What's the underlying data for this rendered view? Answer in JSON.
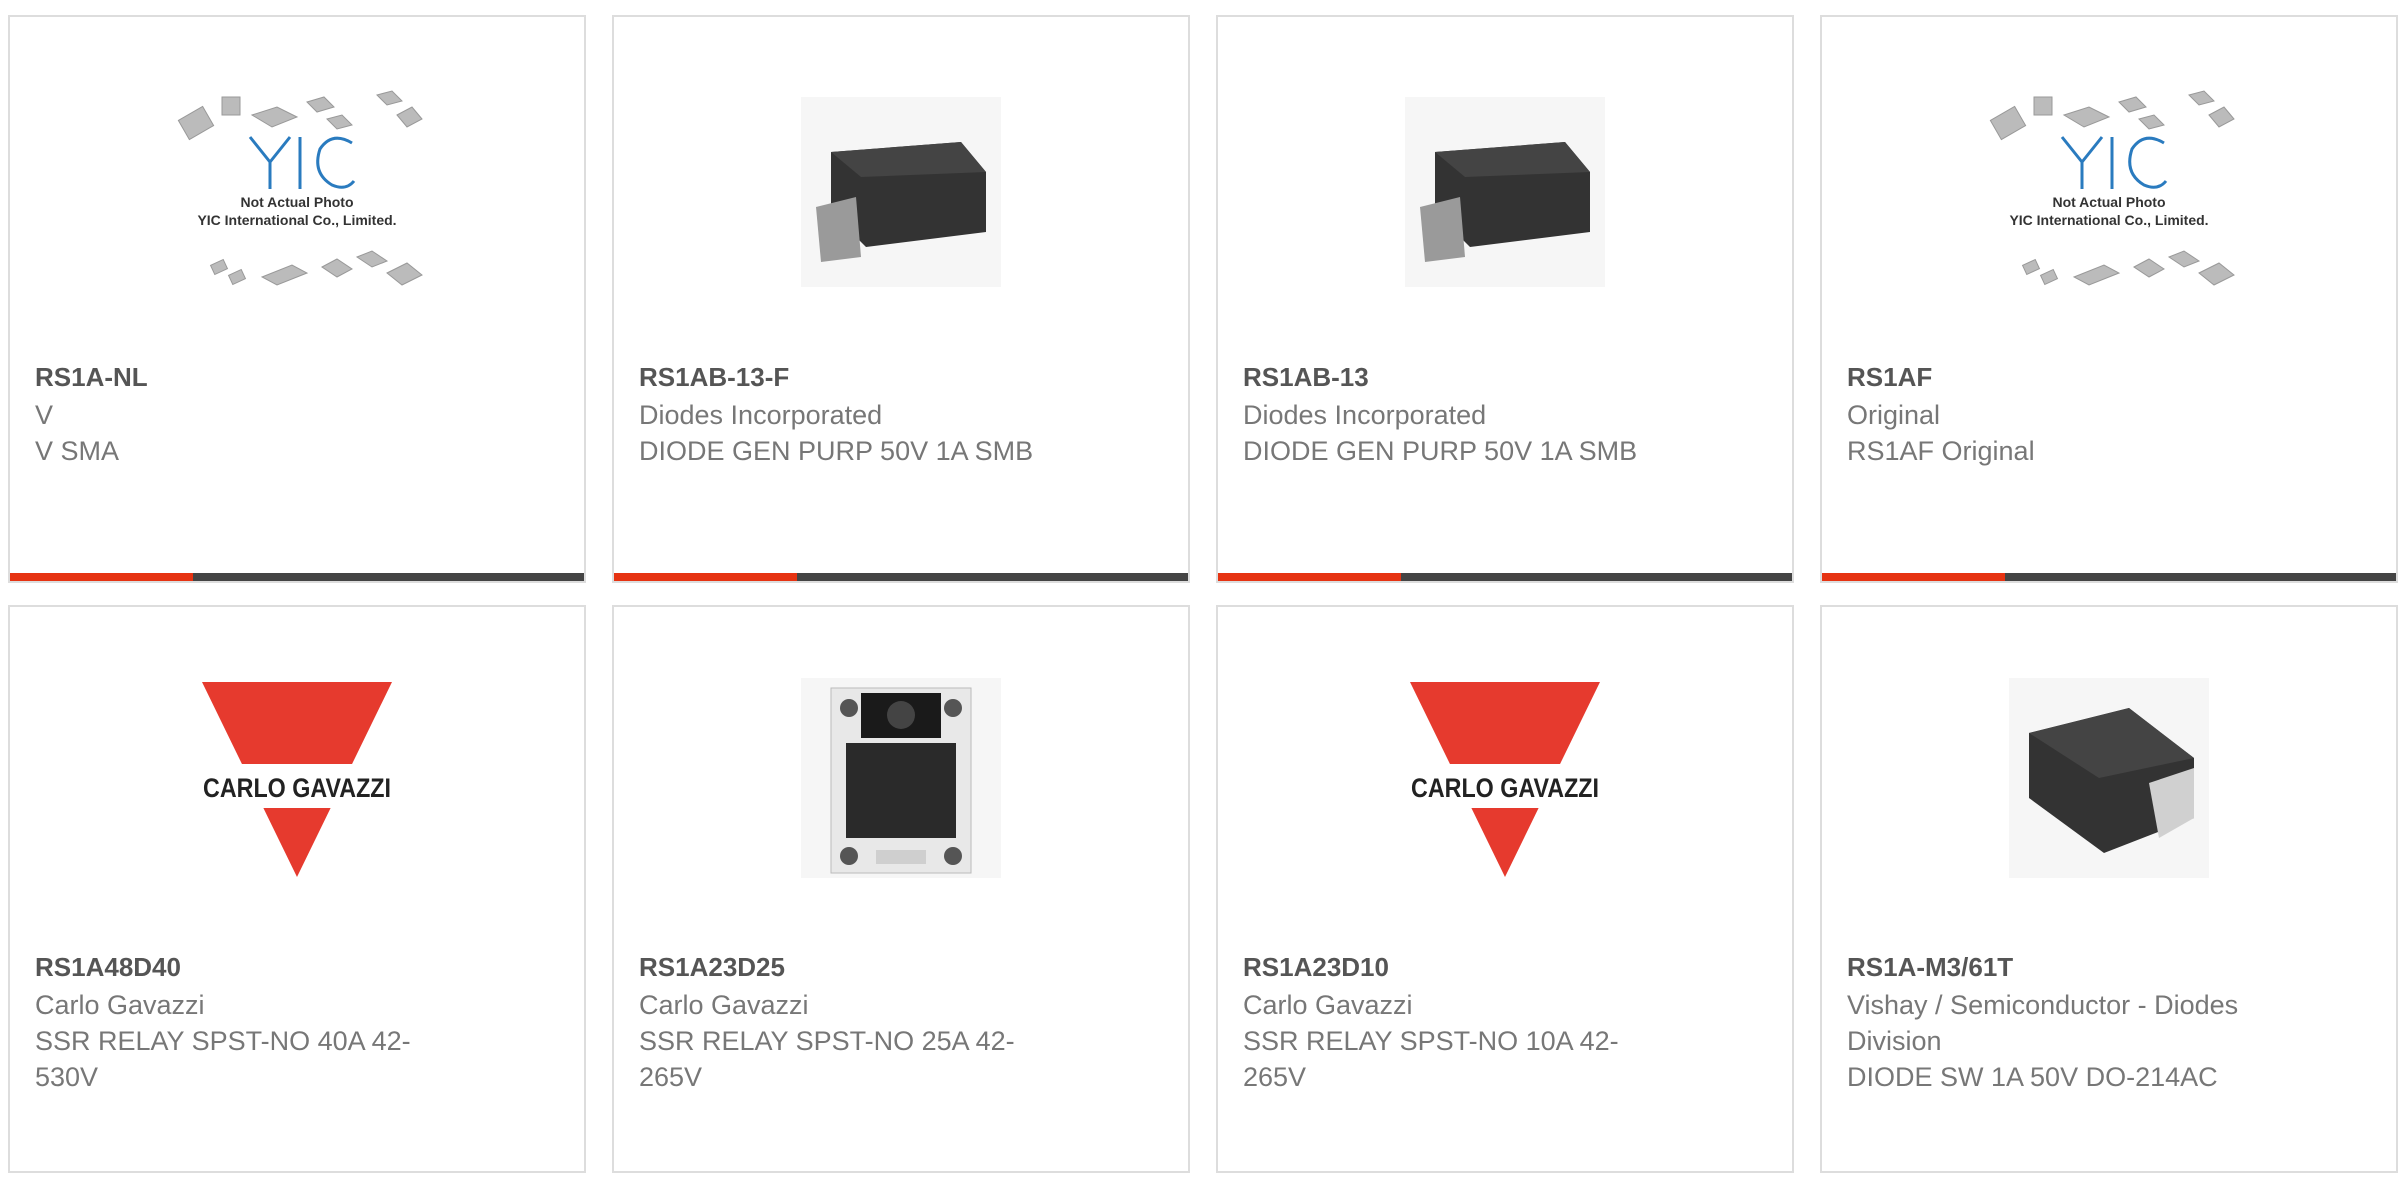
{
  "colors": {
    "accent": "#e63312",
    "bar": "#444444",
    "part_text": "#555555",
    "body_text": "#777777",
    "carlo_red": "#e63a2e"
  },
  "products": [
    {
      "part": "RS1A-NL",
      "manufacturer": "V",
      "description": "V SMA",
      "image": "yic-placeholder",
      "placeholder_brand": "YIC",
      "placeholder_line1": "Not Actual Photo",
      "placeholder_line2": "YIC International Co., Limited."
    },
    {
      "part": "RS1AB-13-F",
      "manufacturer": "Diodes Incorporated",
      "description": "DIODE GEN PURP 50V 1A SMB",
      "image": "smb-diode"
    },
    {
      "part": "RS1AB-13",
      "manufacturer": "Diodes Incorporated",
      "description": "DIODE GEN PURP 50V 1A SMB",
      "image": "smb-diode"
    },
    {
      "part": "RS1AF",
      "manufacturer": "Original",
      "description": "RS1AF Original",
      "image": "yic-placeholder",
      "placeholder_brand": "YIC",
      "placeholder_line1": "Not Actual Photo",
      "placeholder_line2": "YIC International Co., Limited."
    },
    {
      "part": "RS1A48D40",
      "manufacturer": "Carlo Gavazzi",
      "description": "SSR RELAY SPST-NO 40A 42-530V",
      "image": "carlo-gavazzi-logo",
      "logo_text": "CARLO GAVAZZI"
    },
    {
      "part": "RS1A23D25",
      "manufacturer": "Carlo Gavazzi",
      "description": "SSR RELAY SPST-NO 25A 42-265V",
      "image": "ssr-relay"
    },
    {
      "part": "RS1A23D10",
      "manufacturer": "Carlo Gavazzi",
      "description": "SSR RELAY SPST-NO 10A 42-265V",
      "image": "carlo-gavazzi-logo",
      "logo_text": "CARLO GAVAZZI"
    },
    {
      "part": "RS1A-M3/61T",
      "manufacturer": "Vishay / Semiconductor - Diodes Division",
      "description": "DIODE SW 1A 50V DO-214AC",
      "image": "sma-diode"
    }
  ]
}
